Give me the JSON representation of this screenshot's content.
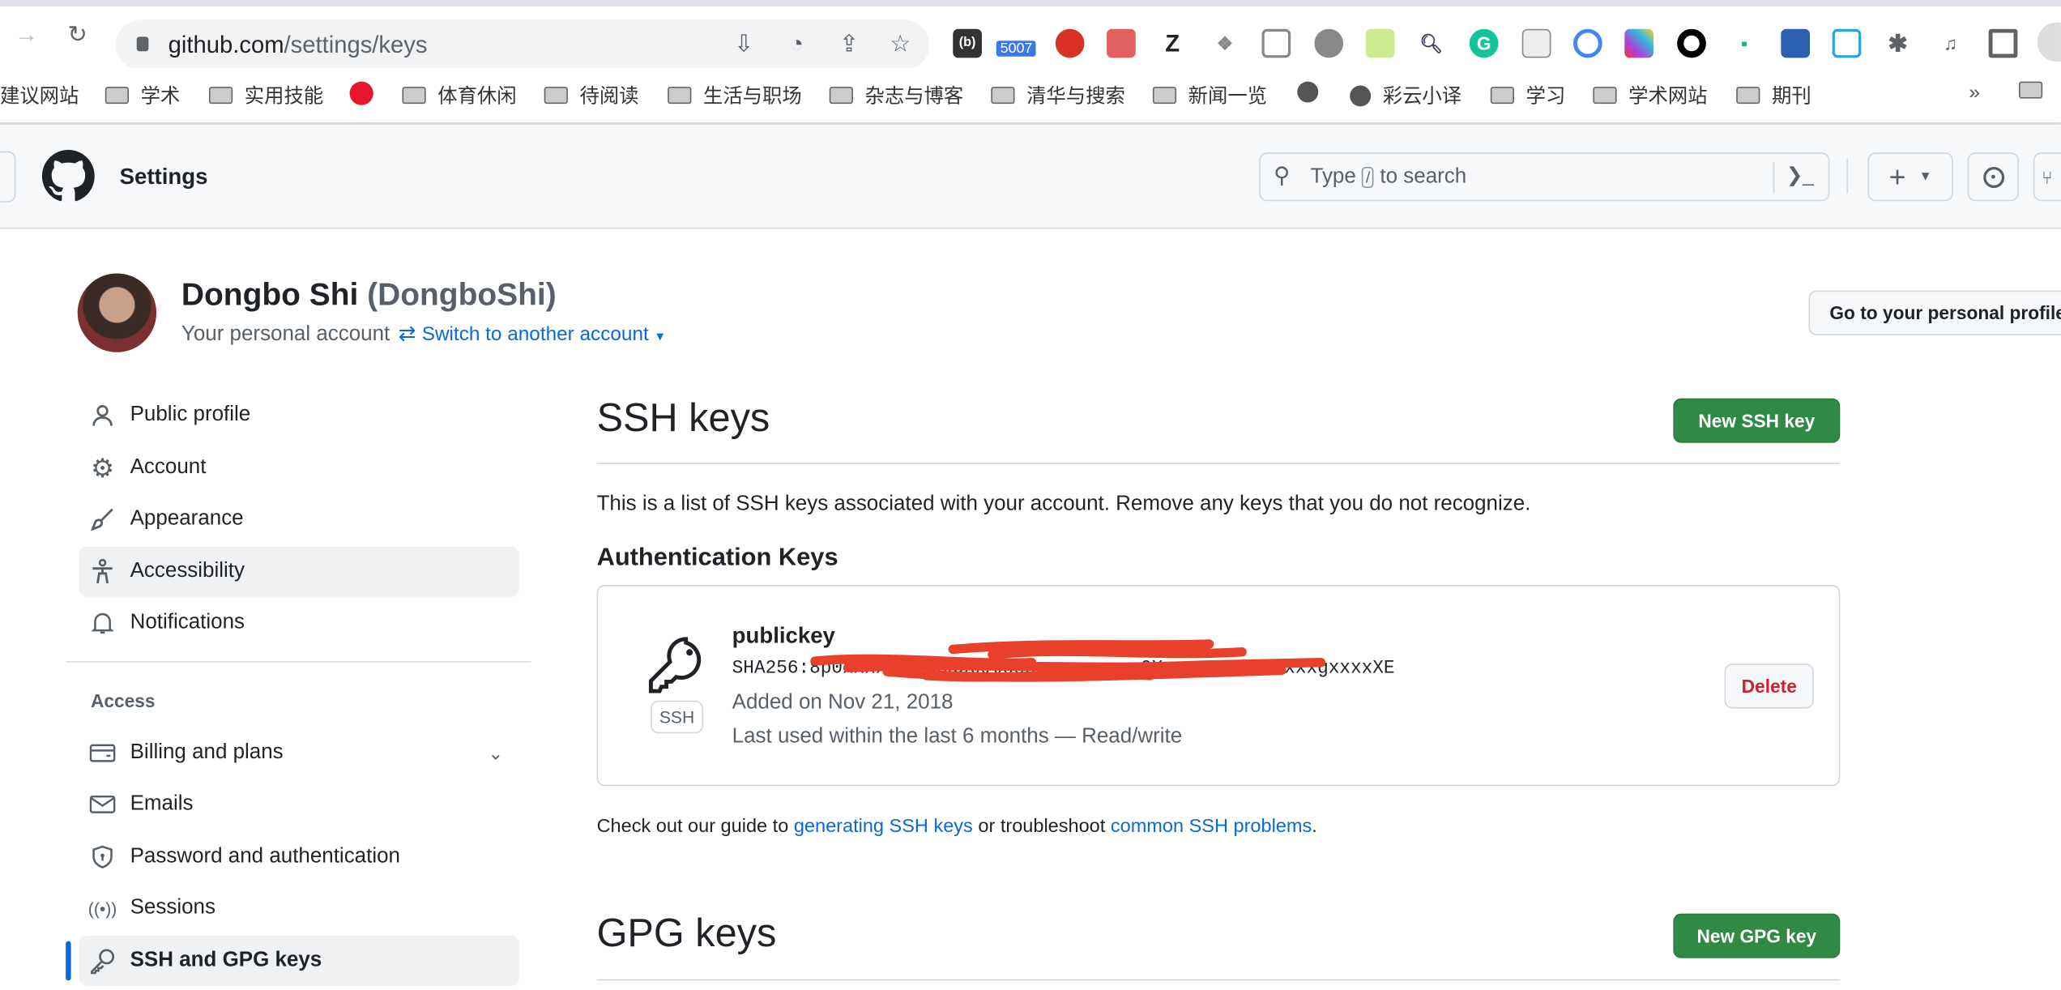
{
  "browser": {
    "url_host": "github.com",
    "url_path": "/settings/keys",
    "extension_badge": "5007",
    "extension_z": "Z",
    "bookmarks": [
      "建议网站",
      "学术",
      "实用技能",
      "体育休闲",
      "待阅读",
      "生活与职场",
      "杂志与博客",
      "清华与搜索",
      "新闻一览",
      "彩云小译",
      "学习",
      "学术网站",
      "期刊"
    ],
    "more": "»"
  },
  "header": {
    "title": "Settings",
    "search_prefix": "Type",
    "search_key": "/",
    "search_suffix": "to search",
    "plus": "+"
  },
  "profile": {
    "name": "Dongbo Shi",
    "username": "(DongboShi)",
    "account_type": "Your personal account",
    "switch_label": "Switch to another account",
    "go_profile": "Go to your personal profile"
  },
  "sidebar": {
    "items": [
      {
        "label": "Public profile",
        "icon": "person-icon"
      },
      {
        "label": "Account",
        "icon": "gear-icon"
      },
      {
        "label": "Appearance",
        "icon": "paintbrush-icon"
      },
      {
        "label": "Accessibility",
        "icon": "accessibility-icon"
      },
      {
        "label": "Notifications",
        "icon": "bell-icon"
      }
    ],
    "section_access": "Access",
    "access_items": [
      {
        "label": "Billing and plans",
        "icon": "credit-card-icon"
      },
      {
        "label": "Emails",
        "icon": "mail-icon"
      },
      {
        "label": "Password and authentication",
        "icon": "shield-lock-icon"
      },
      {
        "label": "Sessions",
        "icon": "broadcast-icon"
      },
      {
        "label": "SSH and GPG keys",
        "icon": "key-icon"
      }
    ]
  },
  "main": {
    "ssh_title": "SSH keys",
    "new_ssh": "New SSH key",
    "description": "This is a list of SSH keys associated with your account. Remove any keys that you do not recognize.",
    "auth_keys_title": "Authentication Keys",
    "key": {
      "title": "publickey",
      "fingerprint_prefix": "SHA256:",
      "type_badge": "SSH",
      "added": "Added on Nov 21, 2018",
      "last_used": "Last used within the last 6 months — Read/write",
      "delete": "Delete"
    },
    "guide_1": "Check out our guide to ",
    "guide_link1": "generating SSH keys",
    "guide_2": " or troubleshoot ",
    "guide_link2": "common SSH problems",
    "guide_3": ".",
    "gpg_title": "GPG keys",
    "new_gpg": "New GPG key"
  },
  "colors": {
    "accent": "#0969da",
    "green": "#2f8a43",
    "danger": "#cf222e",
    "redaction": "#e8402a"
  }
}
